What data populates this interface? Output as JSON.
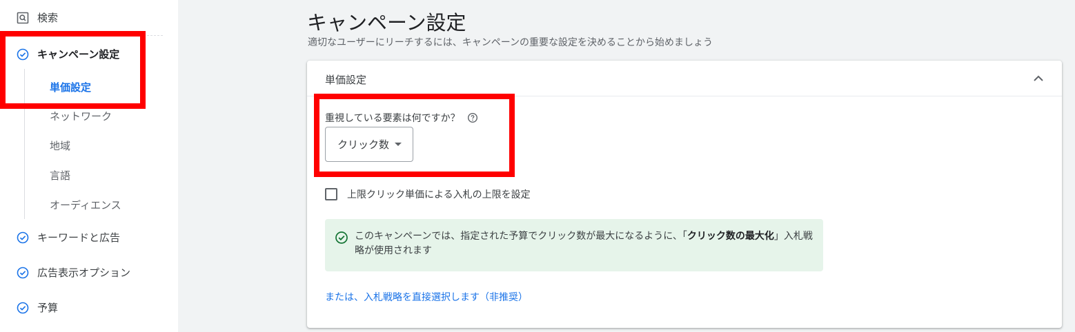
{
  "sidebar": {
    "search_label": "検索",
    "campaign_settings_label": "キャンペーン設定",
    "sub_items": [
      "単価設定",
      "ネットワーク",
      "地域",
      "言語",
      "オーディエンス"
    ],
    "keywords_ads_label": "キーワードと広告",
    "ad_extensions_label": "広告表示オプション",
    "budget_label": "予算"
  },
  "main": {
    "title": "キャンペーン設定",
    "subtitle": "適切なユーザーにリーチするには、キャンペーンの重要な設定を決めることから始めましょう",
    "card": {
      "title": "単価設定",
      "question": "重視している要素は何ですか？",
      "dropdown_value": "クリック数",
      "checkbox_label": "上限クリック単価による入札の上限を設定",
      "info_text_before": "このキャンペーンでは、指定された予算でクリック数が最大になるように、「",
      "info_text_bold": "クリック数の最大化",
      "info_text_after": "」入札戦略が使用されます",
      "link_text": "または、入札戦略を直接選択します（非推奨）"
    }
  },
  "colors": {
    "accent": "#1a73e8",
    "highlight": "#ff0000",
    "success_bg": "#e6f4ea",
    "success_icon": "#137333"
  },
  "icons": [
    "search-icon",
    "check-circle-icon",
    "chevron-up-icon",
    "help-icon",
    "dropdown-caret-icon"
  ]
}
